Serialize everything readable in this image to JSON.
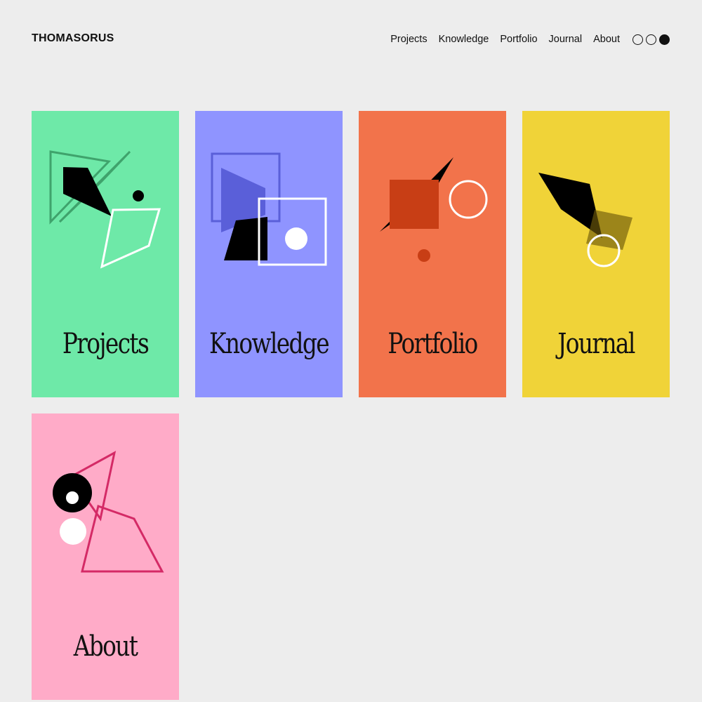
{
  "brand": "THOMASORUS",
  "nav": {
    "items": [
      "Projects",
      "Knowledge",
      "Portfolio",
      "Journal",
      "About"
    ]
  },
  "theme": {
    "options": [
      "light-outline",
      "outline",
      "dark-filled"
    ]
  },
  "cards": [
    {
      "title": "Projects",
      "color": "#6ee9a8"
    },
    {
      "title": "Knowledge",
      "color": "#8f94ff"
    },
    {
      "title": "Portfolio",
      "color": "#f2734b"
    },
    {
      "title": "Journal",
      "color": "#f0d338"
    },
    {
      "title": "About",
      "color": "#ffabc8"
    }
  ]
}
